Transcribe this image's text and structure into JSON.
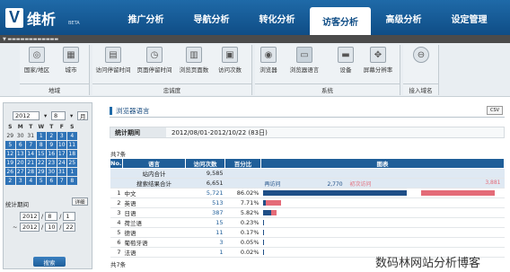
{
  "brand": {
    "mark": "V",
    "name": "维析",
    "beta": "BETA"
  },
  "nav": [
    "推广分析",
    "导航分析",
    "转化分析",
    "访客分析",
    "高级分析",
    "设定管理"
  ],
  "nav_active": 3,
  "toolbar": {
    "groups": [
      {
        "label": "地域",
        "tools": [
          "国家/地区",
          "城市"
        ]
      },
      {
        "label": "忠诚度",
        "tools": [
          "访问停留时间",
          "页面停留时间",
          "浏览页面数",
          "访问次数"
        ]
      },
      {
        "label": "系统",
        "tools": [
          "浏览器",
          "浏览器语言",
          "设备",
          "屏幕分辨率"
        ]
      },
      {
        "label": "接入域名",
        "tools": [
          ""
        ]
      }
    ]
  },
  "calendar": {
    "year": "2012",
    "month": "8",
    "month_suffix": "月",
    "weekdays": [
      "S",
      "M",
      "T",
      "W",
      "T",
      "F",
      "S"
    ],
    "rows": [
      [
        "29",
        "30",
        "31",
        "1",
        "2",
        "3",
        "4"
      ],
      [
        "5",
        "6",
        "7",
        "8",
        "9",
        "10",
        "11"
      ],
      [
        "12",
        "13",
        "14",
        "15",
        "16",
        "17",
        "18"
      ],
      [
        "19",
        "20",
        "21",
        "22",
        "23",
        "24",
        "25"
      ],
      [
        "26",
        "27",
        "28",
        "29",
        "30",
        "31",
        "1"
      ],
      [
        "2",
        "3",
        "4",
        "5",
        "6",
        "7",
        "8"
      ]
    ]
  },
  "stats_period_label": "统计期间",
  "detail_btn": "详细",
  "from": {
    "y": "2012",
    "m": "8",
    "d": "1"
  },
  "to_sep": "~",
  "to": {
    "y": "2012",
    "m": "10",
    "d": "22"
  },
  "search_btn": "搜索",
  "main": {
    "title": "浏览器语言",
    "csv": "CSV",
    "period_label": "统计期间",
    "period_value": "2012/08/01-2012/10/22 (83日)",
    "count_top": "共7条",
    "count_bottom": "共7条"
  },
  "table": {
    "headers": [
      "No.",
      "语言",
      "访问次数",
      "百分比",
      "图表"
    ],
    "sum1": {
      "label": "站内合计",
      "value": "9,585"
    },
    "sum2": {
      "label": "搜索结果合计",
      "value": "6,651"
    },
    "legend": {
      "returning_label": "再访问",
      "returning": "2,770",
      "first_label": "初次访问",
      "first": "3,881"
    },
    "rows": [
      {
        "no": "1",
        "lang": "中文",
        "visits": "5,721",
        "pct": "86.02%",
        "dark": 0.86,
        "pink": 0.0
      },
      {
        "no": "2",
        "lang": "英语",
        "visits": "513",
        "pct": "7.71%",
        "dark": 0.012,
        "pink": 0.065
      },
      {
        "no": "3",
        "lang": "日语",
        "visits": "387",
        "pct": "5.82%",
        "dark": 0.035,
        "pink": 0.023
      },
      {
        "no": "4",
        "lang": "荷兰语",
        "visits": "15",
        "pct": "0.23%",
        "dark": 0.002,
        "pink": 0.0
      },
      {
        "no": "5",
        "lang": "德语",
        "visits": "11",
        "pct": "0.17%",
        "dark": 0.002,
        "pink": 0.0
      },
      {
        "no": "6",
        "lang": "葡萄牙语",
        "visits": "3",
        "pct": "0.05%",
        "dark": 0.001,
        "pink": 0.0
      },
      {
        "no": "7",
        "lang": "法语",
        "visits": "1",
        "pct": "0.02%",
        "dark": 0.001,
        "pink": 0.0
      }
    ]
  },
  "watermark": "数码林网站分析博客",
  "colors": {
    "header": "#1f5e99",
    "dark_bar": "#1f4f87",
    "pink_bar": "#e46b78"
  }
}
